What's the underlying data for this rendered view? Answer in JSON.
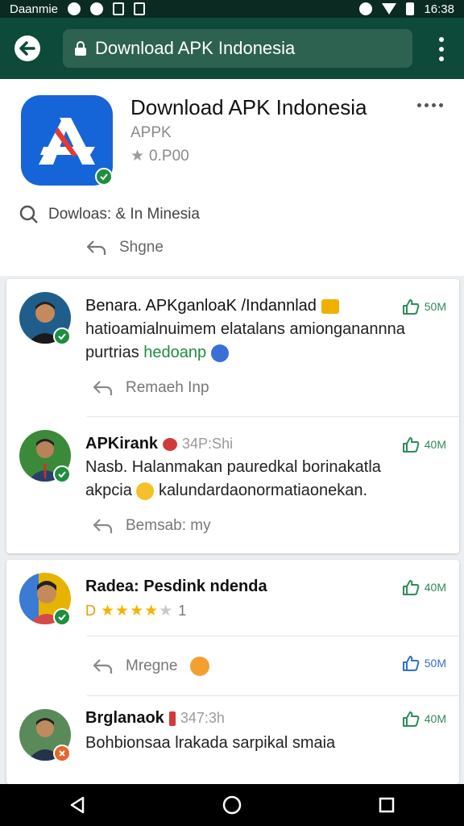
{
  "status_bar": {
    "carrier": "Daanmie",
    "time": "16:38"
  },
  "browser": {
    "url": "Download APK Indonesia"
  },
  "app_header": {
    "title": "Download APK Indonesia",
    "subtitle": "APPK",
    "rating": "0.P00",
    "downloads_text": "Dowloas: & In Minesia",
    "share_label": "Shgne"
  },
  "comments": [
    {
      "author": "Benara. APKganloaK /Indannlad",
      "time": "",
      "likes": "50M",
      "body_line1": "hatioamialnuimem elatalans amionganannna",
      "body_line2_prefix": "purtrias",
      "body_link": "hedoanp",
      "reply_label": "Remaeh Inp"
    },
    {
      "author": "APKirank",
      "time": "34P:Shi",
      "likes": "40M",
      "body_line1": "Nasb. Halanmakan pauredkal borinakatla",
      "body_line2": "akpcia",
      "body_line2_suffix": "kalundardaonormatiaonekan.",
      "reply_label": "Bemsab: my"
    },
    {
      "author": "Radea: Pesdink ndenda",
      "likes": "40M",
      "rating_prefix": "D",
      "rating_value": "1",
      "reply_label": "Mregne",
      "reply_likes": "50M"
    },
    {
      "author": "Brglanaok",
      "time": "347:3h",
      "likes": "40M",
      "body_line1": "Bohbionsaa lrakada sarpikal smaia"
    }
  ],
  "colors": {
    "status_bg": "#0a2a22",
    "appbar_bg": "#0d4a3a",
    "url_bg": "#2d6150",
    "icon_blue": "#1565d8",
    "verified_green": "#1e8e3e",
    "like_green": "#2e8b57",
    "like_blue": "#2f6fd0"
  }
}
